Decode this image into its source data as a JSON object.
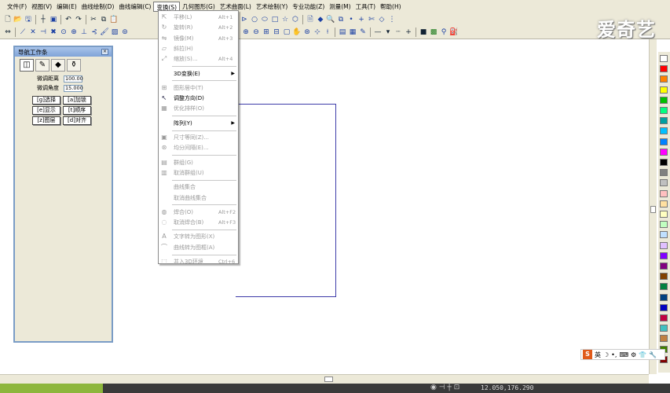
{
  "menubar": {
    "items": [
      "文件(F)",
      "视图(V)",
      "编辑(E)",
      "曲线绘制(D)",
      "曲线编辑(C)",
      "变换(S)",
      "几何图形(G)",
      "艺术曲面(L)",
      "艺术绘制(Y)",
      "专业功能(Z)",
      "测量(M)",
      "工具(T)",
      "帮助(H)"
    ],
    "active_index": 5
  },
  "watermark": "爱奇艺",
  "nav_panel": {
    "title": "导航工作条",
    "tabs": [
      "layers-icon",
      "pen-icon",
      "eraser-icon",
      "bucket-icon"
    ],
    "fields": [
      {
        "label": "微调距离",
        "value": "100.00"
      },
      {
        "label": "微调角度",
        "value": "15.000"
      }
    ],
    "buttons": [
      "[g]选择",
      "[a]加锁",
      "[e]显示",
      "[t]顺序",
      "[z]图层",
      "[d]对齐"
    ]
  },
  "dropdown": {
    "items": [
      {
        "label": "平移(L)",
        "shortcut": "Alt+1",
        "enabled": false,
        "icon": "move-icon"
      },
      {
        "label": "旋转(R)",
        "shortcut": "Alt+2",
        "enabled": false,
        "icon": "rotate-icon"
      },
      {
        "label": "镜像(M)",
        "shortcut": "Alt+3",
        "enabled": false,
        "icon": "mirror-icon"
      },
      {
        "label": "斜拉(H)",
        "shortcut": "",
        "enabled": false,
        "icon": "skew-icon"
      },
      {
        "label": "缩放(S)...",
        "shortcut": "Alt+4",
        "enabled": false,
        "icon": "scale-icon"
      },
      {
        "label": "3D变换(E)",
        "shortcut": "",
        "enabled": true,
        "submenu": true,
        "icon": ""
      },
      {
        "label": "图形居中(T)",
        "shortcut": "",
        "enabled": false,
        "icon": "center-icon"
      },
      {
        "label": "调整方向(D)",
        "shortcut": "",
        "enabled": true,
        "icon": "direction-icon"
      },
      {
        "label": "优化排样(O)",
        "shortcut": "",
        "enabled": false,
        "icon": "nesting-icon"
      },
      {
        "label": "阵列(Y)",
        "shortcut": "",
        "enabled": true,
        "submenu": true,
        "icon": ""
      },
      {
        "label": "尺寸等同(Z)...",
        "shortcut": "",
        "enabled": false,
        "icon": "size-equal-icon"
      },
      {
        "label": "均分间隔(E)...",
        "shortcut": "",
        "enabled": false,
        "icon": "distribute-icon"
      },
      {
        "label": "群组(G)",
        "shortcut": "",
        "enabled": false,
        "icon": "group-icon"
      },
      {
        "label": "取消群组(U)",
        "shortcut": "",
        "enabled": false,
        "icon": "ungroup-icon"
      },
      {
        "label": "曲线集合",
        "shortcut": "",
        "enabled": false,
        "icon": ""
      },
      {
        "label": "取消曲线集合",
        "shortcut": "",
        "enabled": false,
        "icon": ""
      },
      {
        "label": "焊合(O)",
        "shortcut": "Alt+F2",
        "enabled": false,
        "icon": "weld-icon"
      },
      {
        "label": "取消焊合(B)",
        "shortcut": "Alt+F3",
        "enabled": false,
        "icon": "unweld-icon"
      },
      {
        "label": "文字转为图形(X)",
        "shortcut": "",
        "enabled": false,
        "icon": "text-to-shape-icon"
      },
      {
        "label": "曲线转为图框(A)",
        "shortcut": "",
        "enabled": false,
        "icon": "curve-to-frame-icon"
      },
      {
        "label": "并入3D环境",
        "shortcut": "Ctrl+6",
        "enabled": false,
        "icon": "merge-3d-icon"
      }
    ]
  },
  "palette": {
    "colors": [
      "#ffffff",
      "#ff0000",
      "#ff8000",
      "#ffff00",
      "#00c000",
      "#00ff80",
      "#00a0a0",
      "#00c0ff",
      "#0080ff",
      "#ff00ff",
      "#000000",
      "#808080",
      "#c0c0c0",
      "#ffc0c0",
      "#ffe0a0",
      "#ffffc0",
      "#c0ffc0",
      "#c0e0ff",
      "#e0c0ff",
      "#8000ff",
      "#800080",
      "#804000",
      "#008040",
      "#004080",
      "#0000c0",
      "#c00040",
      "#40c0c0",
      "#c08040",
      "#408000",
      "#800000"
    ]
  },
  "status": {
    "coords": "12.050,176.290"
  },
  "ime": {
    "logo": "S",
    "label": "英"
  }
}
